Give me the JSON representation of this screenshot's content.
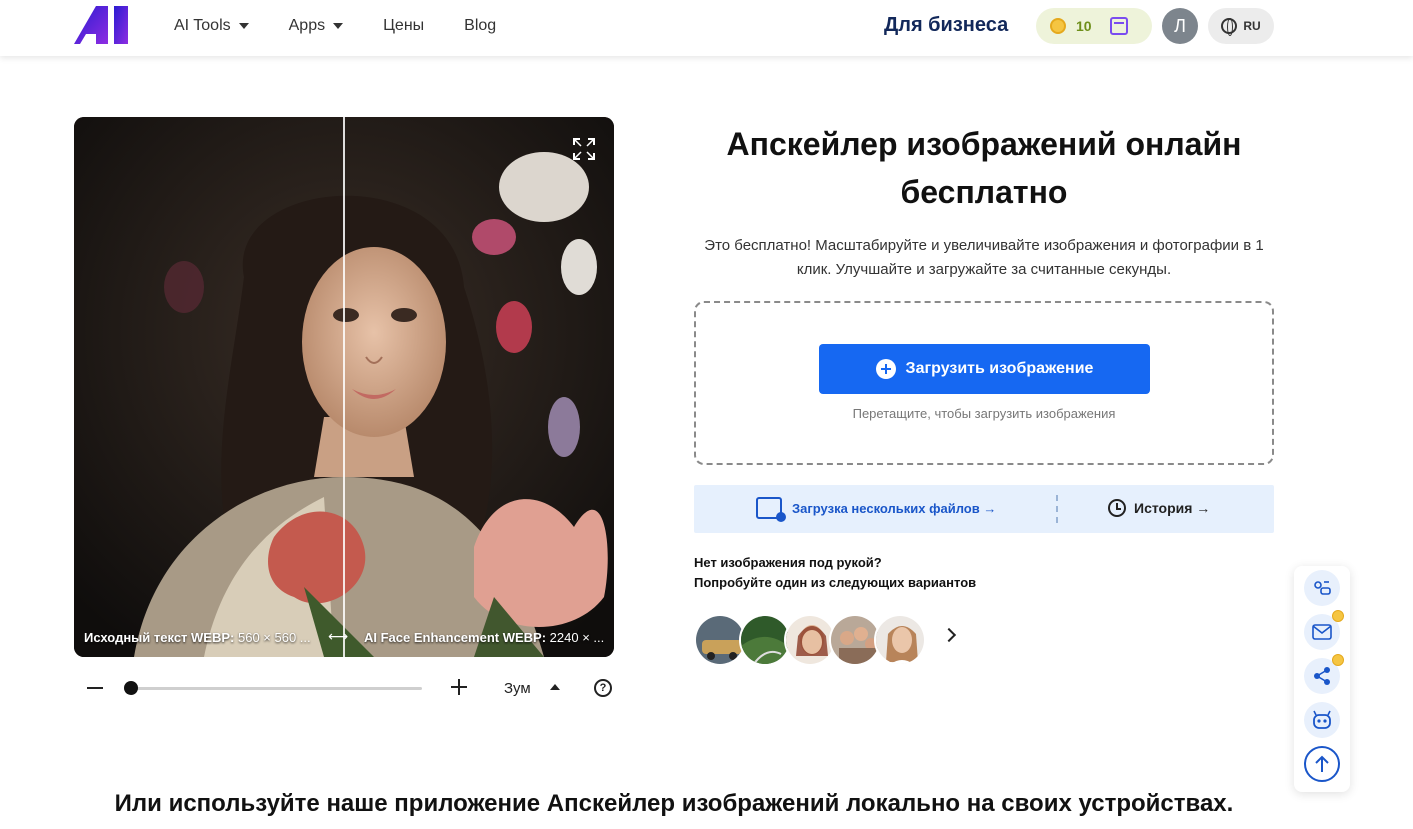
{
  "header": {
    "nav": [
      {
        "label": "AI Tools",
        "dropdown": true
      },
      {
        "label": "Apps",
        "dropdown": true
      },
      {
        "label": "Цены",
        "dropdown": false
      },
      {
        "label": "Blog",
        "dropdown": false
      }
    ],
    "business_link": "Для бизнеса",
    "coins": "10",
    "avatar_letter": "Л",
    "language": "RU",
    "brand_colors": {
      "logo_start": "#3b1fd6",
      "logo_end": "#8a2be2",
      "accent": "#1668f2"
    }
  },
  "compare": {
    "left_label": "Исходный текст WEBP:",
    "left_value": "560 × 560 ...",
    "right_label": "AI Face Enhancement WEBP:",
    "right_value": "2240 × ...",
    "zoom_label": "Зум",
    "zoom_level": 0.0,
    "help": "?"
  },
  "main": {
    "title": "Апскейлер изображений онлайн бесплатно",
    "description": "Это бесплатно! Масштабируйте и увеличивайте изображения и фотографии в 1 клик. Улучшайте и загружайте за считанные секунды.",
    "upload_button": "Загрузить изображение",
    "drop_hint": "Перетащите, чтобы загрузить изображения",
    "multi_upload": "Загрузка нескольких файлов →",
    "history": "История →",
    "try_line1": "Нет изображения под рукой?",
    "try_line2": "Попробуйте один из следующих вариантов"
  },
  "samples": [
    {
      "name": "car-sample",
      "color": "#c9a15a"
    },
    {
      "name": "landscape-sample",
      "color": "#4c7a3a"
    },
    {
      "name": "woman-red-sample",
      "color": "#b06a4a"
    },
    {
      "name": "family-sample",
      "color": "#8a6c58"
    },
    {
      "name": "blonde-woman-sample",
      "color": "#d8b49a"
    }
  ],
  "side_panel": [
    "feedback-icon",
    "mail-icon",
    "share-icon",
    "robot-icon",
    "arrow-up-icon"
  ],
  "bottom": {
    "heading": "Или используйте наше приложение Апскейлер изображений локально на своих устройствах."
  }
}
